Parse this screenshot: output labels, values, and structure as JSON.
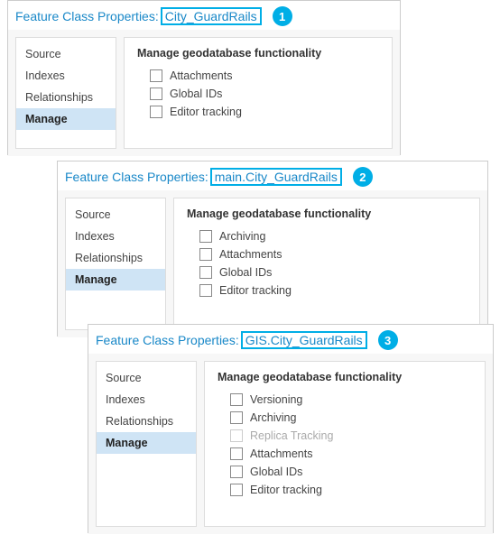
{
  "dialogs": [
    {
      "title_prefix": "Feature Class Properties:",
      "title_name": "City_GuardRails",
      "callout": "1",
      "sidebar": [
        {
          "label": "Source",
          "selected": false
        },
        {
          "label": "Indexes",
          "selected": false
        },
        {
          "label": "Relationships",
          "selected": false
        },
        {
          "label": "Manage",
          "selected": true
        }
      ],
      "heading": "Manage geodatabase functionality",
      "options": [
        {
          "label": "Attachments",
          "disabled": false
        },
        {
          "label": "Global IDs",
          "disabled": false
        },
        {
          "label": "Editor tracking",
          "disabled": false
        }
      ]
    },
    {
      "title_prefix": "Feature Class Properties:",
      "title_name": "main.City_GuardRails",
      "callout": "2",
      "sidebar": [
        {
          "label": "Source",
          "selected": false
        },
        {
          "label": "Indexes",
          "selected": false
        },
        {
          "label": "Relationships",
          "selected": false
        },
        {
          "label": "Manage",
          "selected": true
        }
      ],
      "heading": "Manage geodatabase functionality",
      "options": [
        {
          "label": "Archiving",
          "disabled": false
        },
        {
          "label": "Attachments",
          "disabled": false
        },
        {
          "label": "Global IDs",
          "disabled": false
        },
        {
          "label": "Editor tracking",
          "disabled": false
        }
      ]
    },
    {
      "title_prefix": "Feature Class Properties:",
      "title_name": "GIS.City_GuardRails",
      "callout": "3",
      "sidebar": [
        {
          "label": "Source",
          "selected": false
        },
        {
          "label": "Indexes",
          "selected": false
        },
        {
          "label": "Relationships",
          "selected": false
        },
        {
          "label": "Manage",
          "selected": true
        }
      ],
      "heading": "Manage geodatabase functionality",
      "options": [
        {
          "label": "Versioning",
          "disabled": false
        },
        {
          "label": "Archiving",
          "disabled": false
        },
        {
          "label": "Replica Tracking",
          "disabled": true
        },
        {
          "label": "Attachments",
          "disabled": false
        },
        {
          "label": "Global IDs",
          "disabled": false
        },
        {
          "label": "Editor tracking",
          "disabled": false
        }
      ]
    }
  ]
}
